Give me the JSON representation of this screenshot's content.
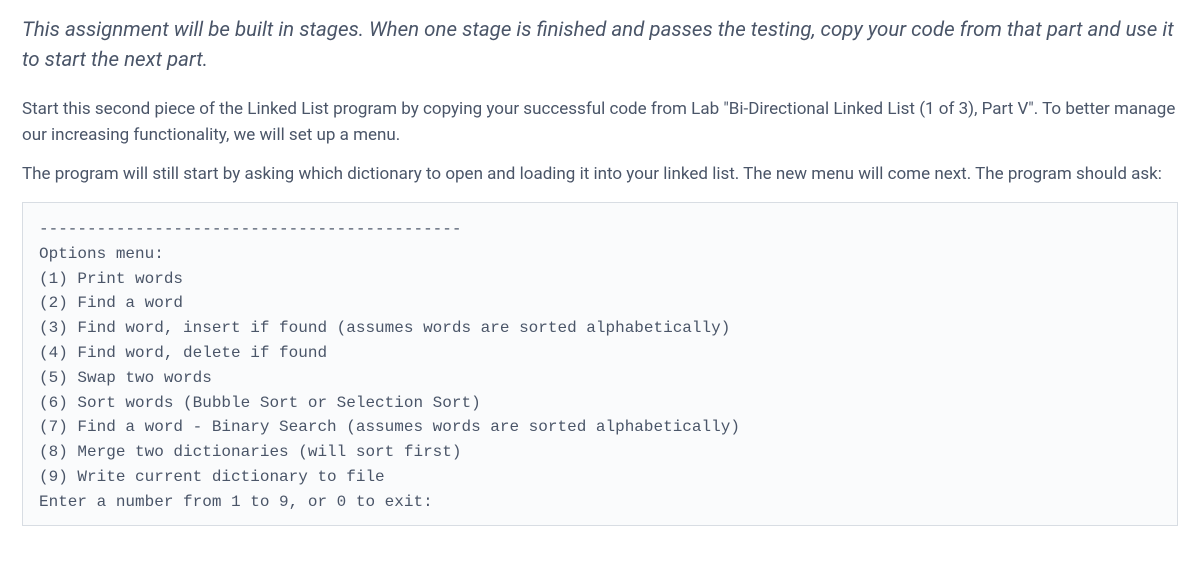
{
  "intro": "This assignment will be built in stages. When one stage is finished and passes the testing, copy your code from that part and use it to start the next part.",
  "para1": "Start this second piece of the Linked List program by copying your successful code from Lab \"Bi-Directional Linked List (1 of 3), Part V\". To better manage our increasing functionality, we will set up a menu.",
  "para2": "The program will still start by asking which dictionary to open and loading it into your linked list. The new menu will come next. The program should ask:",
  "code_block": "--------------------------------------------\nOptions menu:\n(1) Print words\n(2) Find a word\n(3) Find word, insert if found (assumes words are sorted alphabetically)\n(4) Find word, delete if found\n(5) Swap two words\n(6) Sort words (Bubble Sort or Selection Sort)\n(7) Find a word - Binary Search (assumes words are sorted alphabetically)\n(8) Merge two dictionaries (will sort first)\n(9) Write current dictionary to file\nEnter a number from 1 to 9, or 0 to exit:"
}
